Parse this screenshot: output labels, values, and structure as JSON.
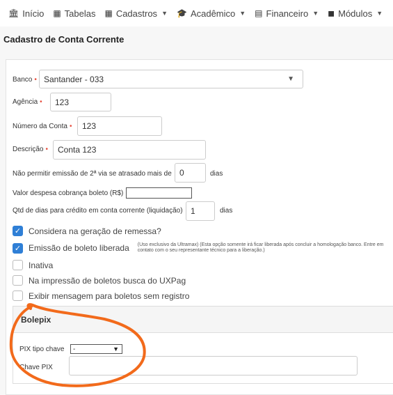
{
  "nav": {
    "items": [
      {
        "label": "Início",
        "icon": "bank-icon",
        "glyph": "🏛",
        "dropdown": false
      },
      {
        "label": "Tabelas",
        "icon": "table-icon",
        "glyph": "▦",
        "dropdown": false
      },
      {
        "label": "Cadastros",
        "icon": "grid-icon",
        "glyph": "▦",
        "dropdown": true
      },
      {
        "label": "Acadêmico",
        "icon": "graduation-cap-icon",
        "glyph": "🎓",
        "dropdown": true
      },
      {
        "label": "Financeiro",
        "icon": "calculator-icon",
        "glyph": "▤",
        "dropdown": true
      },
      {
        "label": "Módulos",
        "icon": "modules-icon",
        "glyph": "◼",
        "dropdown": true
      }
    ]
  },
  "page": {
    "title": "Cadastro de Conta Corrente"
  },
  "form": {
    "banco": {
      "label": "Banco",
      "value": "Santander - 033"
    },
    "agencia": {
      "label": "Agência",
      "value": "123"
    },
    "numero_conta": {
      "label": "Número da Conta",
      "value": "123"
    },
    "descricao": {
      "label": "Descrição",
      "value": "Conta 123"
    },
    "segunda_via": {
      "label": "Não permitir emissão de 2ª via se atrasado mais de",
      "value": "0",
      "suffix": "dias"
    },
    "despesa_boleto": {
      "label": "Valor despesa cobrança boleto (R$)",
      "value": ""
    },
    "dias_credito": {
      "label": "Qtd de dias para crédito em conta corrente (liquidação)",
      "value": "1",
      "suffix": "dias"
    },
    "checkboxes": [
      {
        "label": "Considera na geração de remessa?",
        "checked": true
      },
      {
        "label": "Emissão de boleto liberada",
        "checked": true,
        "note": "(Uso exclusivo da Ultramax) (Esta opção somente irá ficar liberada após concluir a homologação banco. Entre em contato com o seu representante técnico para a liberação.)"
      },
      {
        "label": "Inativa",
        "checked": false
      },
      {
        "label": "Na impressão de boletos busca do UXPag",
        "checked": false
      },
      {
        "label": "Exibir mensagem para boletos sem registro",
        "checked": false
      }
    ]
  },
  "bolepix": {
    "title": "Bolepix",
    "pix_tipo_chave": {
      "label": "PIX tipo chave",
      "value": "-"
    },
    "chave_pix": {
      "label": "Chave PIX",
      "value": ""
    }
  },
  "annotation": {
    "color": "#f26a1b"
  }
}
